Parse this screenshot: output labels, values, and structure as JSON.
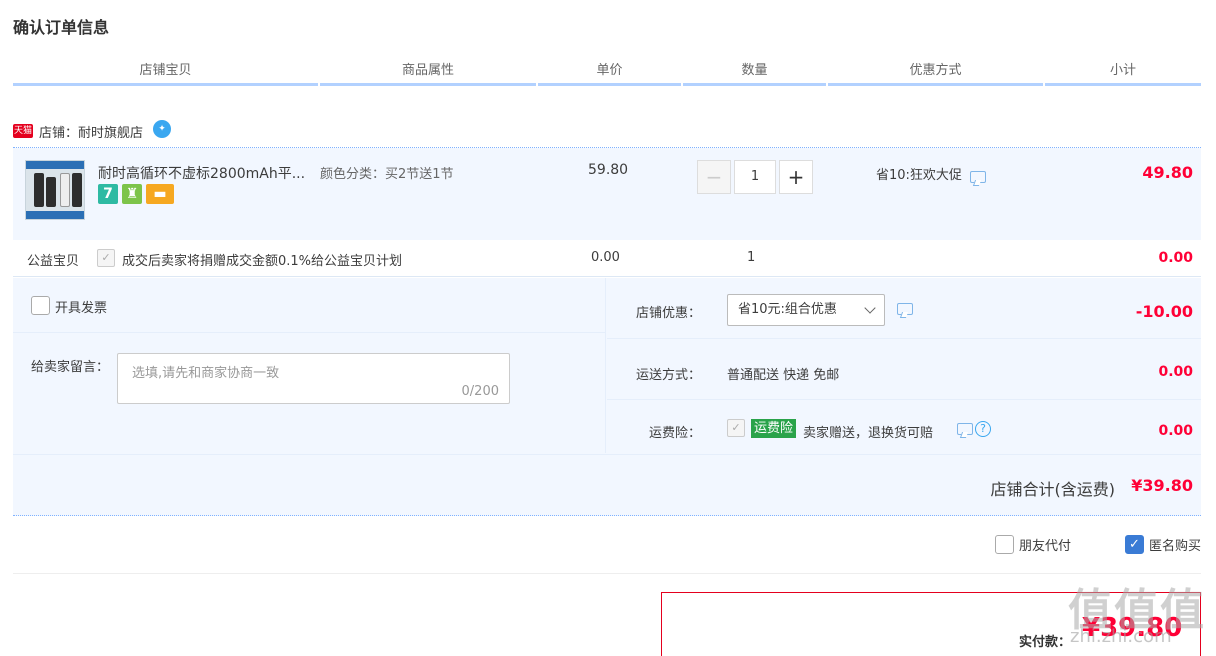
{
  "title": "确认订单信息",
  "columns": [
    "店铺宝贝",
    "商品属性",
    "单价",
    "数量",
    "优惠方式",
    "小计"
  ],
  "shop": {
    "badge": "天猫",
    "label": "店铺：耐时旗舰店",
    "ww_icon": "ww-icon"
  },
  "item": {
    "name": "耐时高循环不虚标2800mAh平...",
    "attr": "颜色分类：买2节送1节",
    "price": "59.80",
    "quantity": "1",
    "minus": "−",
    "plus": "+",
    "promo": "省10:狂欢大促",
    "subtotal": "49.80",
    "service_icons": [
      "7",
      "guard-icon",
      "card-icon"
    ]
  },
  "charity": {
    "label": "公益宝贝",
    "text": "成交后卖家将捐赠成交金额0.1%给公益宝贝计划",
    "price": "0.00",
    "qty": "1",
    "subtotal": "0.00"
  },
  "invoice": {
    "label": "开具发票"
  },
  "memo": {
    "label": "给卖家留言：",
    "placeholder": "选填,请先和商家协商一致",
    "count": "0/200"
  },
  "shop_discount": {
    "label": "店铺优惠：",
    "selected": "省10元:组合优惠",
    "value": "-10.00"
  },
  "shipping": {
    "label": "运送方式：",
    "text": "普通配送 快递 免邮",
    "value": "0.00"
  },
  "insurance": {
    "label": "运费险：",
    "badge": "运费险",
    "text": "卖家赠送，退换货可赔",
    "value": "0.00"
  },
  "shop_total": {
    "label": "店铺合计(含运费)",
    "value": "¥39.80"
  },
  "options": {
    "friend_pay": "朋友代付",
    "anonymous": "匿名购买",
    "anonymous_checked": true
  },
  "payment": {
    "label": "实付款：",
    "amount": "¥39.80"
  },
  "watermark": {
    "text": "值值值",
    "sub": "zhi.zhi.com"
  },
  "colors": {
    "accent_red": "#ff0036",
    "header_line": "#b2d1ff",
    "row_bg": "#f2f7ff"
  }
}
